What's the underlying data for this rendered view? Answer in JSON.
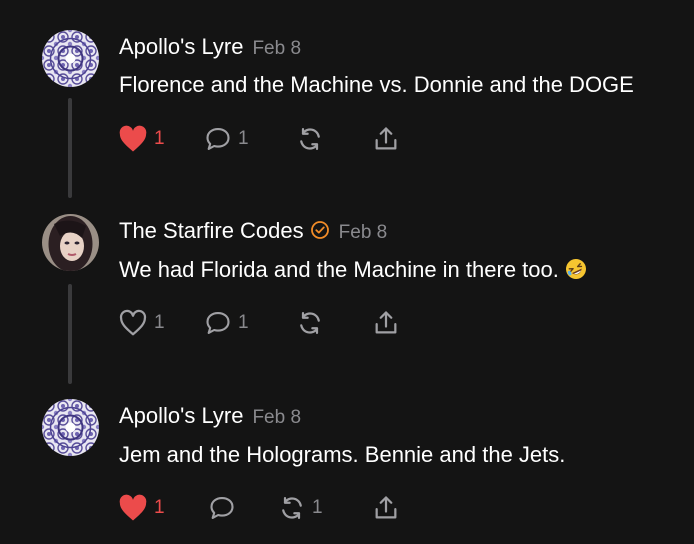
{
  "colors": {
    "background": "#141414",
    "text": "#ffffff",
    "muted": "#8a8a8e",
    "heart_red": "#ec4b4b",
    "verified_orange": "#f28c28",
    "thread_line": "#3a3a3c"
  },
  "posts": [
    {
      "author": "Apollo's Lyre",
      "date": "Feb 8",
      "verified": false,
      "text": "Florence and the Machine vs. Donnie and the DOGE",
      "avatar": "fractal-avatar",
      "like_icon": "heart-filled-icon",
      "likes": "1",
      "comments": "1",
      "restacks": "",
      "liked": true
    },
    {
      "author": "The Starfire Codes",
      "date": "Feb 8",
      "verified": true,
      "text": "We had Florida and the Machine in there too.",
      "emoji": "rolling-on-floor-laughing-emoji",
      "avatar": "portrait-avatar",
      "like_icon": "heart-outline-icon",
      "likes": "1",
      "comments": "1",
      "restacks": "",
      "liked": false
    },
    {
      "author": "Apollo's Lyre",
      "date": "Feb 8",
      "verified": false,
      "text": "Jem and the Holograms. Bennie and the Jets.",
      "avatar": "fractal-avatar",
      "like_icon": "heart-filled-icon",
      "likes": "1",
      "comments": "",
      "restacks": "1",
      "liked": true
    }
  ]
}
